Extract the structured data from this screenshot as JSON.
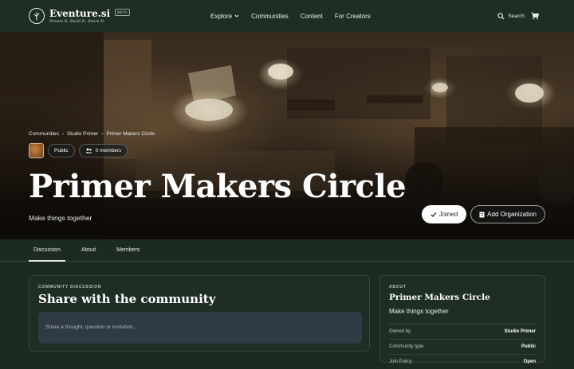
{
  "nav": {
    "brand": "Eventure.si",
    "tagline": "Dream It. Build It. Share It.",
    "beta": "BETA",
    "links": [
      "Explore",
      "Communities",
      "Content",
      "For Creators"
    ],
    "search_label": "Search"
  },
  "hero": {
    "breadcrumb": [
      "Communities",
      "Studio Primer",
      "Primer Makers Circle"
    ],
    "visibility": "Public",
    "members": "0 members",
    "title": "Primer Makers Circle",
    "subtitle": "Make things together",
    "joined_label": "Joined",
    "add_org_label": "Add Organization"
  },
  "tabs": [
    "Discussion",
    "About",
    "Members"
  ],
  "discussion": {
    "eyebrow": "COMMUNITY DISCUSSION",
    "title": "Share with the community",
    "placeholder": "Share a thought, question or invitation..."
  },
  "about": {
    "eyebrow": "ABOUT",
    "title": "Primer Makers Circle",
    "description": "Make things together",
    "rows": [
      {
        "label": "Owned by",
        "value": "Studio Primer"
      },
      {
        "label": "Community type",
        "value": "Public"
      },
      {
        "label": "Join Policy",
        "value": "Open"
      }
    ]
  }
}
